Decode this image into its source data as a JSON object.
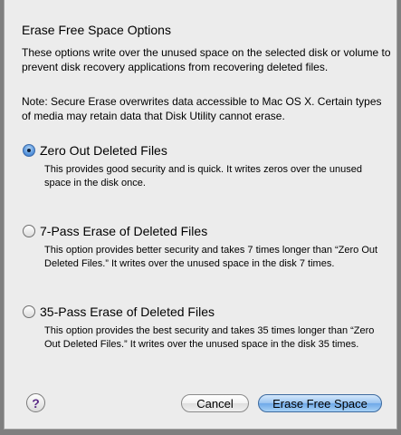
{
  "dialog": {
    "title": "Erase Free Space Options",
    "intro": "These options write over the unused space on the selected disk or volume to prevent disk recovery applications from recovering deleted files.",
    "note": "Note: Secure Erase overwrites data accessible to Mac OS X.  Certain types of media may retain data that Disk Utility cannot erase."
  },
  "options": [
    {
      "label": "Zero Out Deleted Files",
      "selected": true,
      "description": "This provides good security and is quick. It writes zeros over the unused space in the disk once."
    },
    {
      "label": "7-Pass Erase of Deleted Files",
      "selected": false,
      "description": "This option provides better security and takes 7 times longer than “Zero Out Deleted Files.” It writes over the unused space in the disk 7 times."
    },
    {
      "label": "35-Pass Erase of Deleted Files",
      "selected": false,
      "description": "This option provides the best security and takes 35 times longer than “Zero Out Deleted Files.” It writes over the unused space in the disk 35 times."
    }
  ],
  "buttons": {
    "help_glyph": "?",
    "cancel": "Cancel",
    "confirm": "Erase Free Space"
  },
  "colors": {
    "window_background": "#ececec",
    "default_button": "#6ea8e8",
    "selected_radio": "#3b6aa9"
  },
  "icons": {
    "help": "help-icon"
  }
}
